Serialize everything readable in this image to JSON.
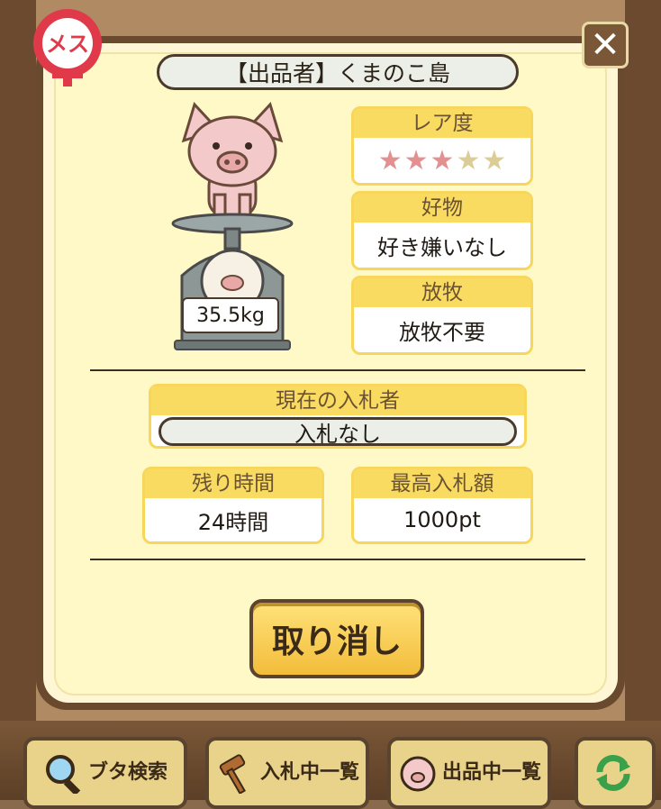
{
  "gender_badge": "メス",
  "seller": "【出品者】くまのこ島",
  "weight": "35.5kg",
  "rarity": {
    "label": "レア度",
    "stars_filled": 3,
    "stars_total": 5,
    "stars_text": "★★★★★"
  },
  "favorite": {
    "label": "好物",
    "value": "好き嫌いなし"
  },
  "grazing": {
    "label": "放牧",
    "value": "放牧不要"
  },
  "current_bidder": {
    "label": "現在の入札者",
    "value": "入札なし"
  },
  "remaining_time": {
    "label": "残り時間",
    "value": "24時間"
  },
  "highest_bid": {
    "label": "最高入札額",
    "value": "1000pt"
  },
  "cancel_button": "取り消し",
  "close_icon": "close-icon",
  "bottom_nav": [
    {
      "label": "ブタ検索",
      "icon": "magnifier-icon"
    },
    {
      "label": "入札中一覧",
      "icon": "gavel-icon"
    },
    {
      "label": "出品中一覧",
      "icon": "pig-icon"
    },
    {
      "label": "",
      "icon": "refresh-icon"
    }
  ],
  "colors": {
    "accent_yellow": "#f9db62",
    "frame_brown": "#6a4a2e",
    "panel_cream": "#fff8c7",
    "star_on": "#e29090",
    "star_off": "#dccd96"
  }
}
